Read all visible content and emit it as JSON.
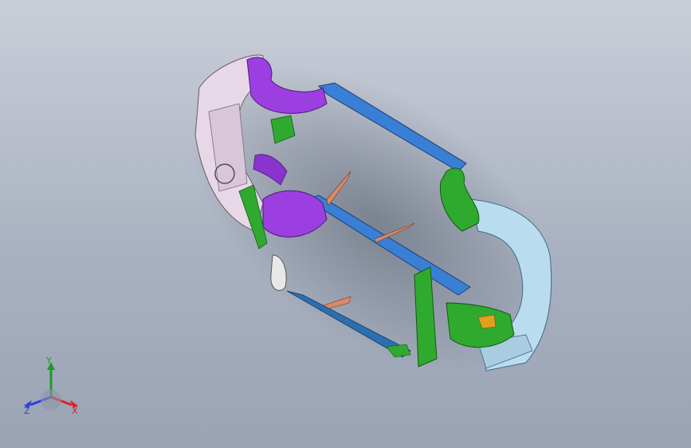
{
  "viewport": {
    "background_top": "#c9ced8",
    "background_bottom": "#9aa3b4"
  },
  "model": {
    "parts": [
      {
        "name": "front-bumper-fascia",
        "color": "#e6d8e6"
      },
      {
        "name": "front-wheel-liner-upper",
        "color": "#9b3fe0"
      },
      {
        "name": "front-wheel-liner-lower",
        "color": "#9b3fe0"
      },
      {
        "name": "side-sill-beam",
        "color": "#3a7fd6"
      },
      {
        "name": "rear-bumper-fascia",
        "color": "#b9dcef"
      },
      {
        "name": "rear-wheel-liner-upper",
        "color": "#2faa2f"
      },
      {
        "name": "rear-wheel-liner-lower",
        "color": "#2faa2f"
      },
      {
        "name": "side-trim-panel",
        "color": "#2faa2f"
      },
      {
        "name": "mudflap-strips",
        "color": "#d98a6a"
      },
      {
        "name": "lower-skirt-strip",
        "color": "#2c6fb0"
      },
      {
        "name": "bracket",
        "color": "#e8e8e8"
      }
    ]
  },
  "triad": {
    "x_label": "X",
    "y_label": "Y",
    "z_label": "Z",
    "x_color": "#e02020",
    "y_color": "#1f9a2a",
    "z_color": "#2a3ee0"
  }
}
